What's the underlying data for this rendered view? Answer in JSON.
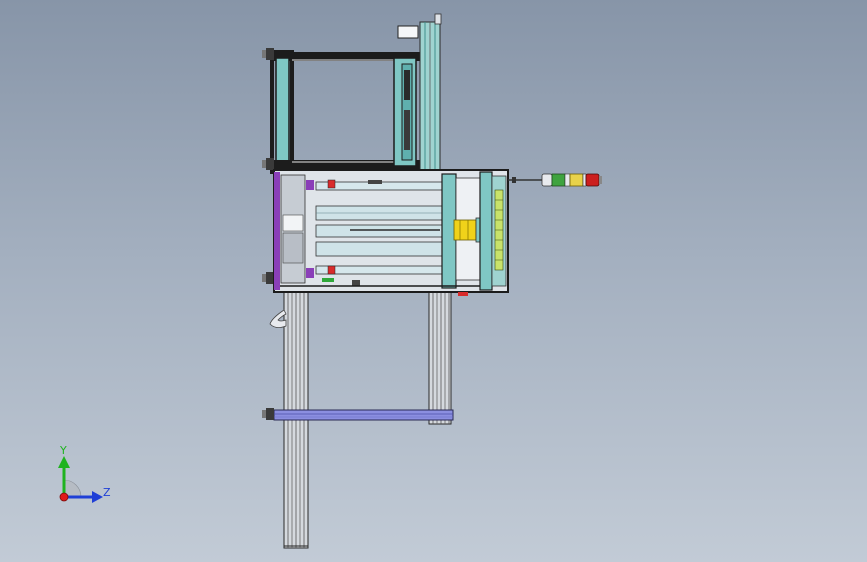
{
  "triad": {
    "y_label": "Y",
    "z_label": "Z",
    "colors": {
      "y": "#1fb31f",
      "z": "#1f3fd6",
      "x": "#e01a1a"
    }
  },
  "palette": {
    "frame_dark": "#1c1c1c",
    "teal": "#7fc7c4",
    "teal_dark": "#3f8f8d",
    "grey_profile": "#c9cdd2",
    "grey_light": "#e3e6ea",
    "purple": "#8a3fb8",
    "purple_rail": "#7f7fd6",
    "yellow": "#f0d21a",
    "red": "#d92b2b",
    "green": "#2fa83a",
    "lamp_yellow": "#e8d24a",
    "lamp_red": "#cc1f1f",
    "lamp_green": "#3fa33f"
  }
}
